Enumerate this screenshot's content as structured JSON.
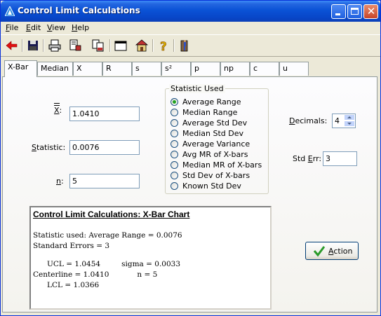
{
  "window": {
    "title": "Control Limit Calculations"
  },
  "menu": {
    "file": {
      "u": "F",
      "rest": "ile"
    },
    "edit": {
      "u": "E",
      "rest": "dit"
    },
    "view": {
      "u": "V",
      "rest": "iew"
    },
    "help": {
      "u": "H",
      "rest": "elp"
    }
  },
  "tabs": [
    "X-Bar",
    "Median",
    "X",
    "R",
    "s",
    "s²",
    "p",
    "np",
    "c",
    "u"
  ],
  "fields": {
    "xbarbar_label": "X",
    "xbarbar_value": "1.0410",
    "statistic_label_u": "S",
    "statistic_label_rest": "tatistic:",
    "statistic_value": "0.0076",
    "n_label_u": "n",
    "n_value": "5"
  },
  "statistic_used": {
    "title": "Statistic Used",
    "options": [
      "Average Range",
      "Median Range",
      "Average Std Dev",
      "Median Std Dev",
      "Average Variance",
      "Avg MR of X-bars",
      "Median MR of X-bars",
      "Std Dev of X-bars",
      "Known Std Dev"
    ],
    "selected": 0
  },
  "decimals": {
    "label_u": "D",
    "label_rest": "ecimals:",
    "value": "4"
  },
  "std_err": {
    "label_pre": "Std ",
    "label_u": "E",
    "label_rest": "rr:",
    "value": "3"
  },
  "output": {
    "title": "Control Limit Calculations:  X-Bar Chart",
    "lines": [
      "Statistic used: Average Range = 0.0076",
      "Standard Errors = 3",
      "",
      "      UCL = 1.0454         sigma = 0.0033",
      "Centerline = 1.0410            n = 5",
      "      LCL = 1.0366"
    ]
  },
  "action": {
    "u": "A",
    "rest": "ction"
  },
  "colors": {
    "titlebar": "#0a52d6",
    "window_border": "#0831d9",
    "face": "#ece9d8",
    "check": "#2a9a2a"
  },
  "icons": [
    "back-arrow-icon",
    "save-icon",
    "print-icon",
    "print-preview-icon",
    "copy-icon",
    "paste-icon",
    "window-icon",
    "home-icon",
    "help-icon",
    "exit-icon"
  ]
}
